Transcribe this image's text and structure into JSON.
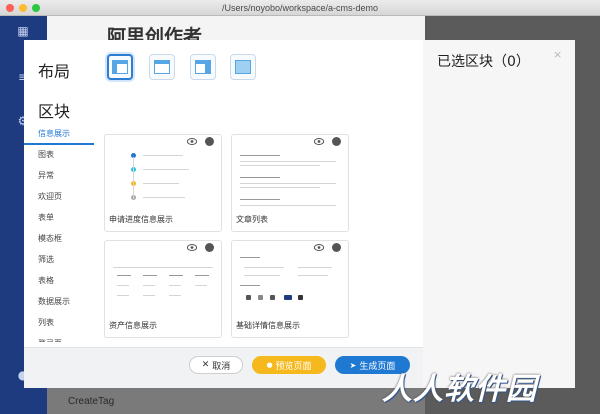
{
  "window": {
    "title": "/Users/noyobo/workspace/a-cms-demo"
  },
  "background": {
    "app_title": "阿里创作者",
    "list_item": "CreateTag"
  },
  "modal": {
    "layout_label": "布局",
    "block_label": "区块",
    "categories": [
      "信息展示",
      "图表",
      "异常",
      "欢迎页",
      "表单",
      "模态框",
      "筛选",
      "表格",
      "数据展示",
      "列表",
      "登录页"
    ],
    "active_category": "信息展示",
    "cards": [
      "申请进度信息展示",
      "文章列表",
      "资产信息展示",
      "基础详情信息展示"
    ],
    "selected_title": "已选区块（0）",
    "close_icon": "×",
    "footer": {
      "cancel_label": "取消",
      "cancel_icon": "✕",
      "preview_label": "预览页面",
      "preview_icon": "●",
      "generate_label": "生成页面",
      "generate_icon": "➤"
    }
  },
  "watermark": "人人软件园",
  "colors": {
    "primary": "#1f78d1",
    "warning": "#f5b81d",
    "sidebar": "#1f3b80"
  }
}
